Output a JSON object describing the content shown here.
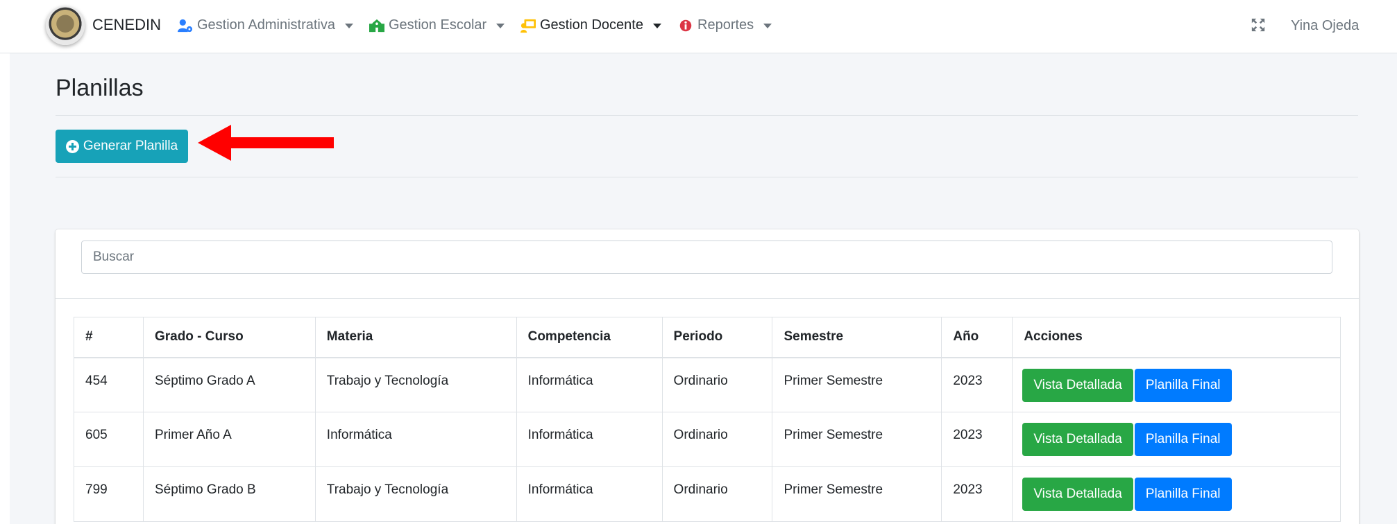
{
  "navbar": {
    "brand": "CENEDIN",
    "menus": [
      {
        "label": "Gestion Administrativa",
        "icon": "users-cog-icon"
      },
      {
        "label": "Gestion Escolar",
        "icon": "school-icon"
      },
      {
        "label": "Gestion Docente",
        "icon": "chalkboard-teacher-icon"
      },
      {
        "label": "Reportes",
        "icon": "info-circle-icon"
      }
    ],
    "user": "Yina Ojeda"
  },
  "page": {
    "title": "Planillas",
    "generate_button": "Generar Planilla"
  },
  "search": {
    "placeholder": "Buscar"
  },
  "table": {
    "headers": [
      "#",
      "Grado - Curso",
      "Materia",
      "Competencia",
      "Periodo",
      "Semestre",
      "Año",
      "Acciones"
    ],
    "rows": [
      {
        "id": "454",
        "grado": "Séptimo Grado A",
        "materia": "Trabajo y Tecnología",
        "competencia": "Informática",
        "periodo": "Ordinario",
        "semestre": "Primer Semestre",
        "anio": "2023"
      },
      {
        "id": "605",
        "grado": "Primer Año A",
        "materia": "Informática",
        "competencia": "Informática",
        "periodo": "Ordinario",
        "semestre": "Primer Semestre",
        "anio": "2023"
      },
      {
        "id": "799",
        "grado": "Séptimo Grado B",
        "materia": "Trabajo y Tecnología",
        "competencia": "Informática",
        "periodo": "Ordinario",
        "semestre": "Primer Semestre",
        "anio": "2023"
      }
    ],
    "actions": {
      "detail": "Vista Detallada",
      "final": "Planilla Final"
    }
  },
  "colors": {
    "info": "#17a2b8",
    "success": "#28a745",
    "primary": "#007bff",
    "arrow": "#ff0000",
    "background": "#f4f6f9"
  }
}
